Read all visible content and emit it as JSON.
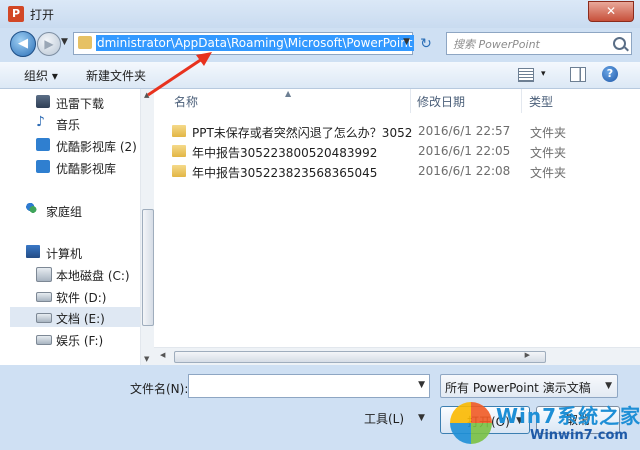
{
  "window": {
    "title": "打开",
    "close_glyph": "✕",
    "app_icon_letter": "P"
  },
  "nav": {
    "back_glyph": "◀",
    "forward_glyph": "▶",
    "address": "dministrator\\AppData\\Roaming\\Microsoft\\PowerPoint",
    "refresh_glyph": "↻",
    "search_placeholder": "搜索 PowerPoint"
  },
  "toolbar": {
    "organize": "组织 ▾",
    "new_folder": "新建文件夹",
    "view_drop": "▾"
  },
  "sidebar": {
    "items": [
      {
        "label": "迅雷下载",
        "icon": "download-icon"
      },
      {
        "label": "音乐",
        "icon": "music-icon"
      },
      {
        "label": "优酷影视库 (2)",
        "icon": "video-library-icon"
      },
      {
        "label": "优酷影视库",
        "icon": "video-library-icon"
      },
      {
        "label": "家庭组",
        "icon": "homegroup-icon"
      },
      {
        "label": "计算机",
        "icon": "computer-icon"
      },
      {
        "label": "本地磁盘 (C:)",
        "icon": "system-drive-icon"
      },
      {
        "label": "软件 (D:)",
        "icon": "drive-icon"
      },
      {
        "label": "文档 (E:)",
        "icon": "drive-icon",
        "selected": true
      },
      {
        "label": "娱乐 (F:)",
        "icon": "drive-icon"
      }
    ]
  },
  "filelist": {
    "columns": [
      "名称",
      "修改日期",
      "类型"
    ],
    "rows": [
      {
        "name": "PPT未保存或者突然闪退了怎么办？3052...",
        "date": "2016/6/1 22:57",
        "type": "文件夹"
      },
      {
        "name": "年中报告305223800520483992",
        "date": "2016/6/1 22:05",
        "type": "文件夹"
      },
      {
        "name": "年中报告305223823568365045",
        "date": "2016/6/1 22:08",
        "type": "文件夹"
      }
    ]
  },
  "bottom": {
    "filename_label": "文件名(N):",
    "filename_value": "",
    "filter": "所有 PowerPoint 演示文稿",
    "tools": "工具(L)",
    "open": "打开(O)",
    "cancel": "取消"
  },
  "watermark": {
    "big": "Win7系统之家",
    "small": "Winwin7.com"
  }
}
